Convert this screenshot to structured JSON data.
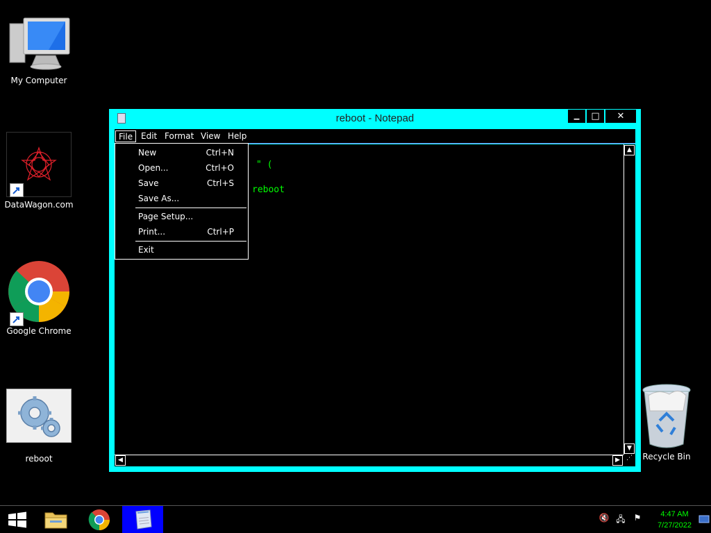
{
  "desktop": {
    "icons": [
      {
        "label": "My Computer"
      },
      {
        "label": "DataWagon.com"
      },
      {
        "label": "Google Chrome"
      },
      {
        "label": "reboot"
      },
      {
        "label": "Recycle Bin"
      }
    ]
  },
  "window": {
    "title": "reboot - Notepad",
    "controls": {
      "minimize": "▁",
      "maximize": "□",
      "close": "✕"
    },
    "menu": [
      "File",
      "Edit",
      "Format",
      "View",
      "Help"
    ],
    "editor_lines": [
      "\" (",
      "reboot"
    ]
  },
  "file_menu": {
    "items": [
      {
        "label": "New",
        "shortcut": "Ctrl+N"
      },
      {
        "label": "Open...",
        "shortcut": "Ctrl+O"
      },
      {
        "label": "Save",
        "shortcut": "Ctrl+S"
      },
      {
        "label": "Save As...",
        "shortcut": ""
      },
      {
        "label": "Page Setup...",
        "shortcut": ""
      },
      {
        "label": "Print...",
        "shortcut": "Ctrl+P"
      },
      {
        "label": "Exit",
        "shortcut": ""
      }
    ]
  },
  "taskbar": {
    "clock_time": "4:47 AM",
    "clock_date": "7/27/2022"
  },
  "colors": {
    "window_border": "#00ffff",
    "editor_text": "#00ff00",
    "active_task": "#0000ff"
  }
}
